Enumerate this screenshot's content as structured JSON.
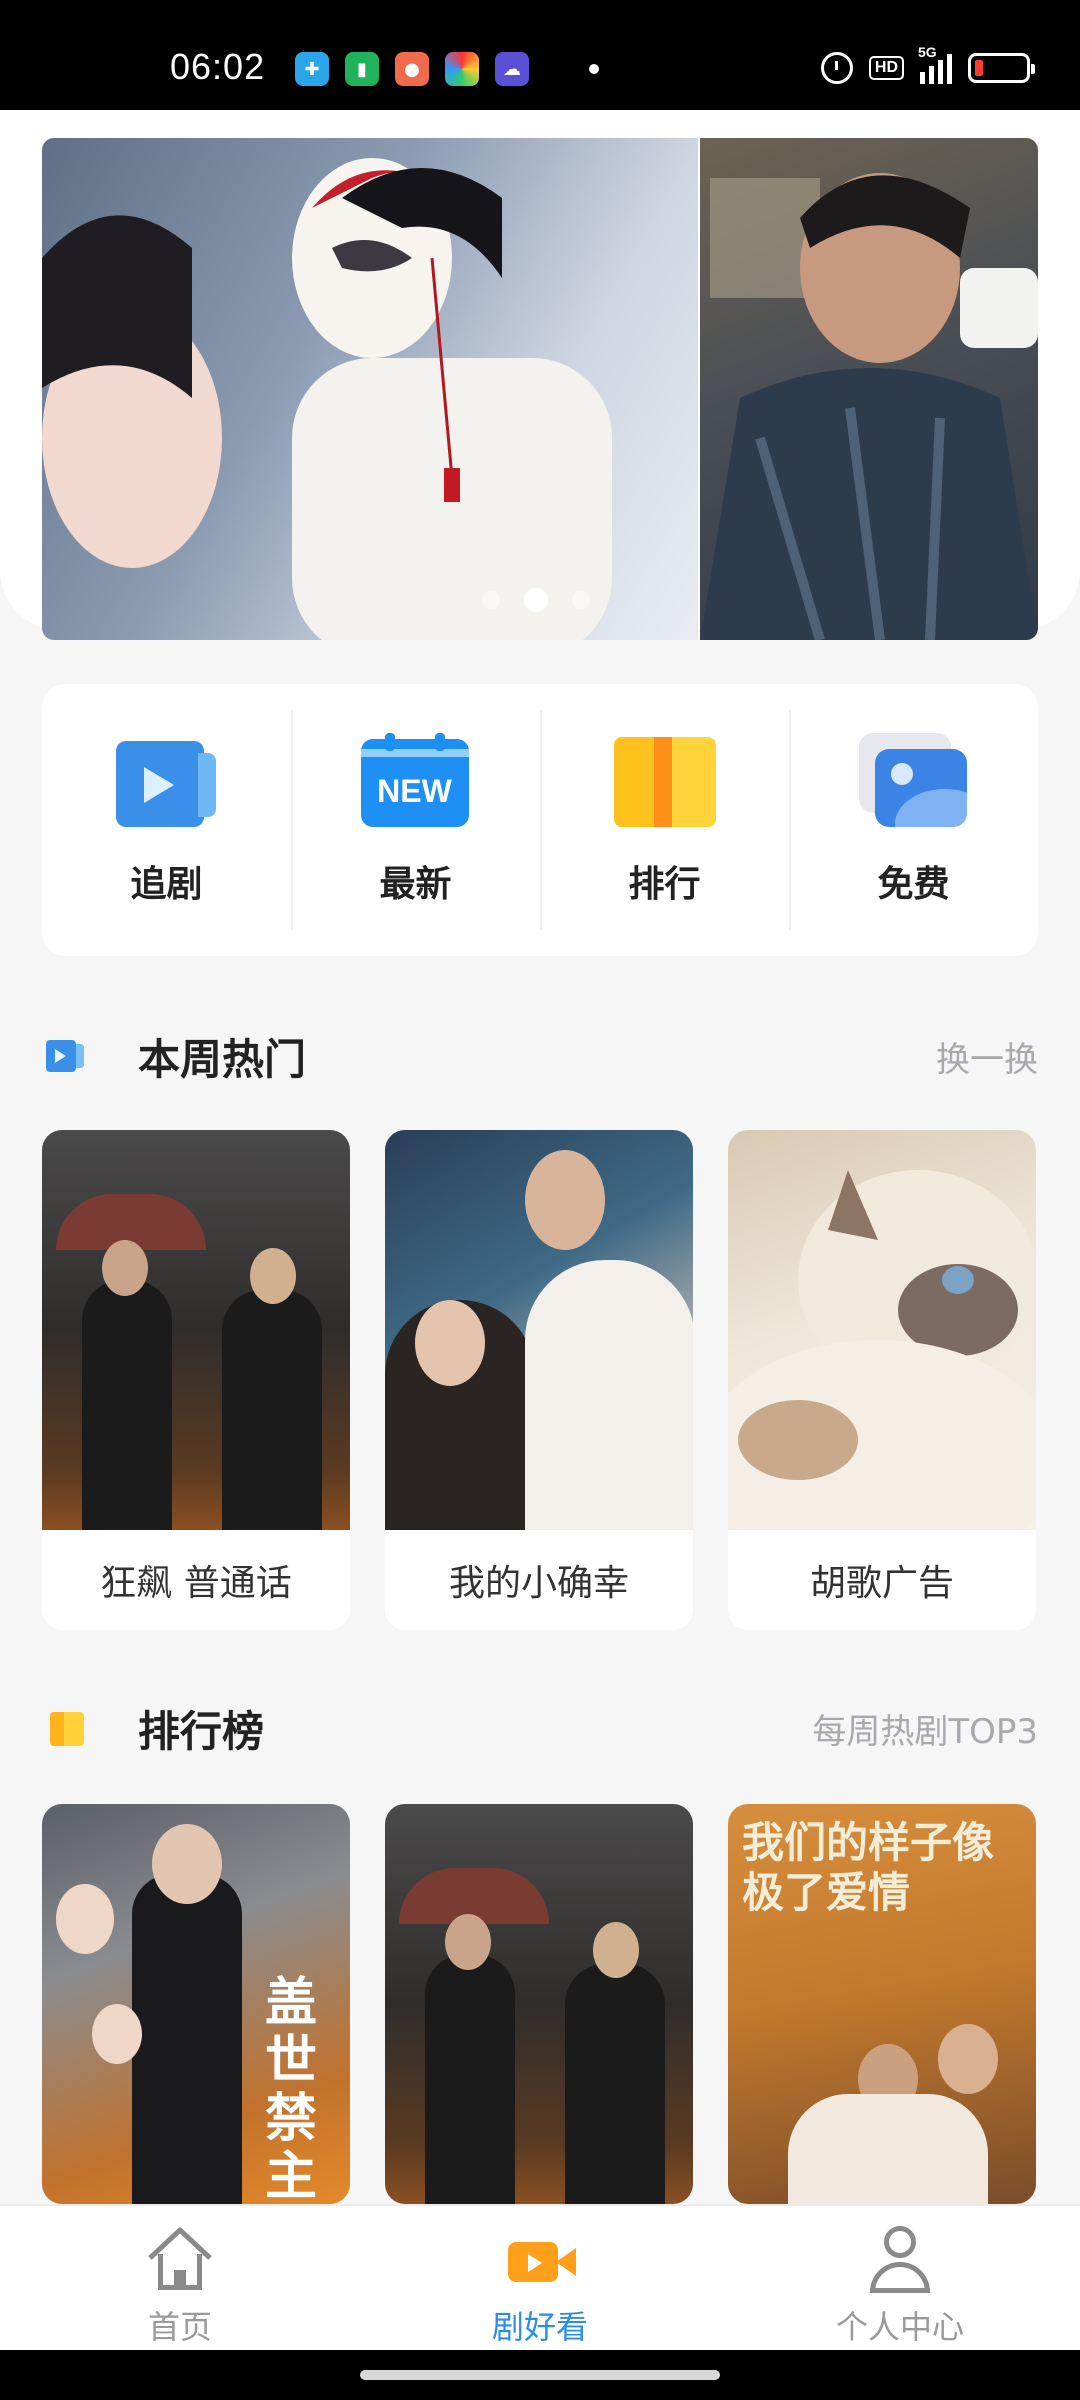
{
  "status_bar": {
    "time": "06:02",
    "network": "5G",
    "hd": "HD",
    "app_icons": [
      "health-app-icon",
      "battery-app-icon",
      "chili-app-icon",
      "colorwheel-app-icon",
      "weather-app-icon"
    ]
  },
  "banner": {
    "slides": [
      "banner-costume-drama",
      "banner-modern-drama"
    ],
    "active_index": 1,
    "dot_count": 3
  },
  "categories": [
    {
      "label": "追剧",
      "icon": "play-card-icon"
    },
    {
      "label": "最新",
      "icon": "new-calendar-icon",
      "badge": "NEW"
    },
    {
      "label": "排行",
      "icon": "rank-bars-icon"
    },
    {
      "label": "免费",
      "icon": "free-image-icon"
    }
  ],
  "hot_section": {
    "title": "本周热门",
    "more": "换一换",
    "items": [
      {
        "title": "狂飙 普通话"
      },
      {
        "title": "我的小确幸"
      },
      {
        "title": "胡歌广告"
      }
    ]
  },
  "rank_section": {
    "title": "排行榜",
    "more": "每周热剧TOP3",
    "items": [
      {
        "poster_text": "盖世禁主"
      },
      {
        "poster_text": ""
      },
      {
        "poster_text": "我们的样子像极了爱情"
      }
    ]
  },
  "bottom_nav": [
    {
      "label": "首页",
      "icon": "home-icon",
      "active": false
    },
    {
      "label": "剧好看",
      "icon": "video-camera-icon",
      "active": true
    },
    {
      "label": "个人中心",
      "icon": "user-icon",
      "active": false
    }
  ],
  "colors": {
    "accent": "#2a8ee8",
    "nav_active_icon": "#ff9f1a",
    "muted": "#a9a9ad"
  }
}
